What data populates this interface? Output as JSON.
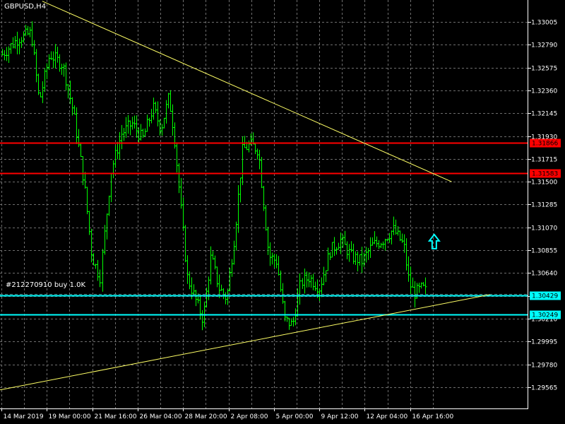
{
  "chart_data": {
    "type": "candlestick",
    "symbol_label": "GBPUSD,H4",
    "order_label": "#212270910 buy 1.0K",
    "y_ticks": [
      "1.33005",
      "1.32790",
      "1.32575",
      "1.32360",
      "1.32145",
      "1.31930",
      "1.31715",
      "1.31500",
      "1.31285",
      "1.31070",
      "1.30855",
      "1.30640",
      "1.30425",
      "1.30210",
      "1.29995",
      "1.29780",
      "1.29565"
    ],
    "x_ticks": [
      "14 Mar 2019",
      "19 Mar 00:00",
      "21 Mar 16:00",
      "26 Mar 04:00",
      "28 Mar 20:00",
      "2 Apr 08:00",
      "5 Apr 00:00",
      "9 Apr 12:00",
      "12 Apr 04:00",
      "16 Apr 16:00"
    ],
    "ylim": [
      1.2945,
      1.333
    ],
    "horizontal_levels": [
      {
        "label": "1.31866",
        "value": 1.31866,
        "color": "#ff0000"
      },
      {
        "label": "1.31583",
        "value": 1.31583,
        "color": "#ff0000"
      },
      {
        "label": "1.30429",
        "value": 1.30429,
        "color": "#00ffff"
      },
      {
        "label": "1.30249",
        "value": 1.30249,
        "color": "#00ffff"
      }
    ],
    "trendlines": [
      {
        "name": "upper",
        "x": [
          0.08,
          0.855
        ],
        "y": [
          1.332,
          1.315
        ],
        "color": "#ffff66"
      },
      {
        "name": "lower",
        "x": [
          0.0,
          0.93
        ],
        "y": [
          1.2954,
          1.3044
        ],
        "color": "#ffff66"
      }
    ],
    "buy_arrow": {
      "x": 0.822,
      "y": 1.3093,
      "color": "#00ffff"
    },
    "candle_color": "#00ff00",
    "grid": true,
    "background": "#000000"
  }
}
